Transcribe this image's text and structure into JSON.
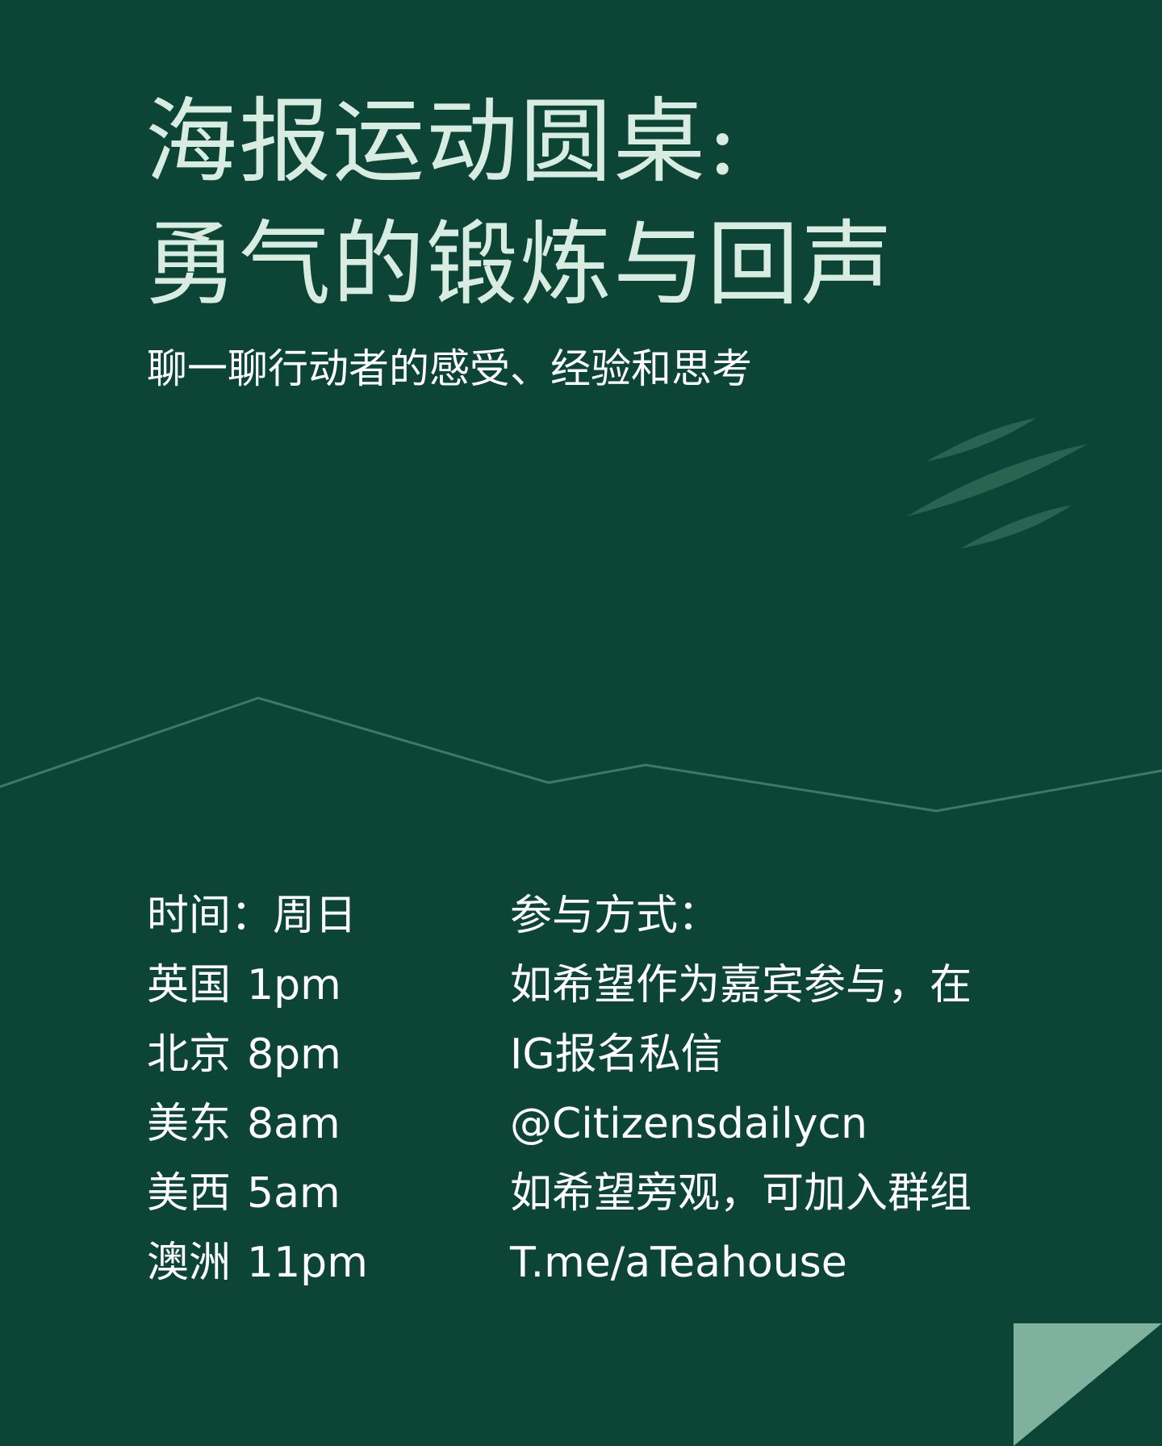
{
  "poster": {
    "title_lines": [
      "海报运动圆桌:",
      "勇气的锻炼与回声"
    ],
    "subtitle": "聊一聊行动者的感受、经验和思考",
    "schedule": {
      "heading": "时间：周日",
      "times": [
        {
          "region": "英国",
          "time": "1pm"
        },
        {
          "region": "北京",
          "time": "8pm"
        },
        {
          "region": "美东",
          "time": "8am"
        },
        {
          "region": "美西",
          "time": "5am"
        },
        {
          "region": "澳洲",
          "time": "11pm"
        }
      ]
    },
    "participation": {
      "heading": "参与方式：",
      "lines": [
        "如希望作为嘉宾参与，在",
        "IG报名私信",
        "@Citizensdailycn",
        "如希望旁观，可加入群组",
        "T.me/aTeahouse"
      ]
    }
  },
  "colors": {
    "background": "#0c4535",
    "title": "#d9ece2",
    "text": "#ffffff",
    "line": "#3e7a63",
    "leaf": "#2a6350",
    "corner": "#7fb29e"
  }
}
